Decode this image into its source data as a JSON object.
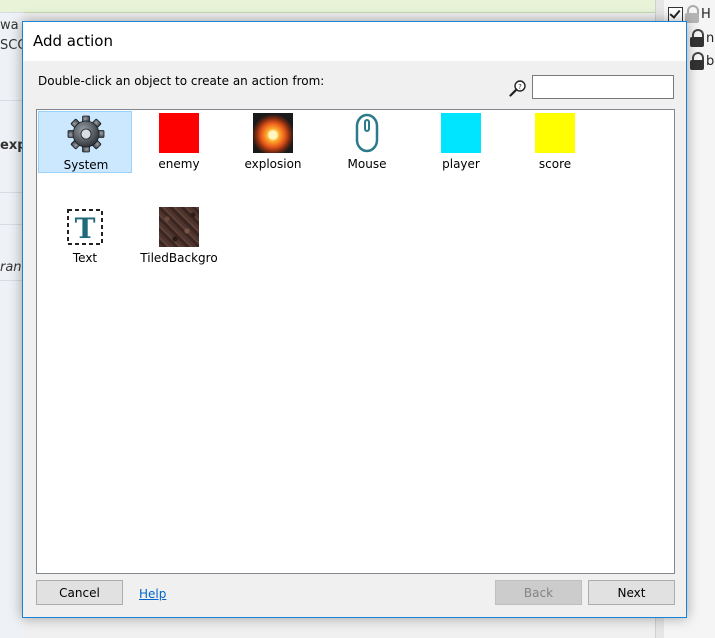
{
  "background": {
    "left_fragments": [
      "wa",
      "SCO",
      "expl",
      "ran"
    ],
    "right_rows": [
      {
        "label": "H"
      },
      {
        "label": "n"
      },
      {
        "label": "b"
      }
    ]
  },
  "dialog": {
    "title": "Add action",
    "instruction": "Double-click an object to create an action from:",
    "search": {
      "value": "",
      "placeholder": ""
    },
    "objects": [
      {
        "name": "System",
        "icon": "gear-icon",
        "selected": true
      },
      {
        "name": "enemy",
        "icon": "solid-color",
        "color": "#ff0000"
      },
      {
        "name": "explosion",
        "icon": "explosion-sprite"
      },
      {
        "name": "Mouse",
        "icon": "mouse-icon"
      },
      {
        "name": "player",
        "icon": "solid-color",
        "color": "#00e5ff"
      },
      {
        "name": "score",
        "icon": "solid-color",
        "color": "#ffff00"
      },
      {
        "name": "Text",
        "icon": "text-object-icon"
      },
      {
        "name": "TiledBackgro",
        "icon": "tiled-background-texture"
      }
    ],
    "buttons": {
      "cancel": "Cancel",
      "help": "Help",
      "back": "Back",
      "next": "Next"
    },
    "colors": {
      "accent_border": "#1883d7",
      "selection": "#cce8ff",
      "link": "#0066cc"
    }
  }
}
